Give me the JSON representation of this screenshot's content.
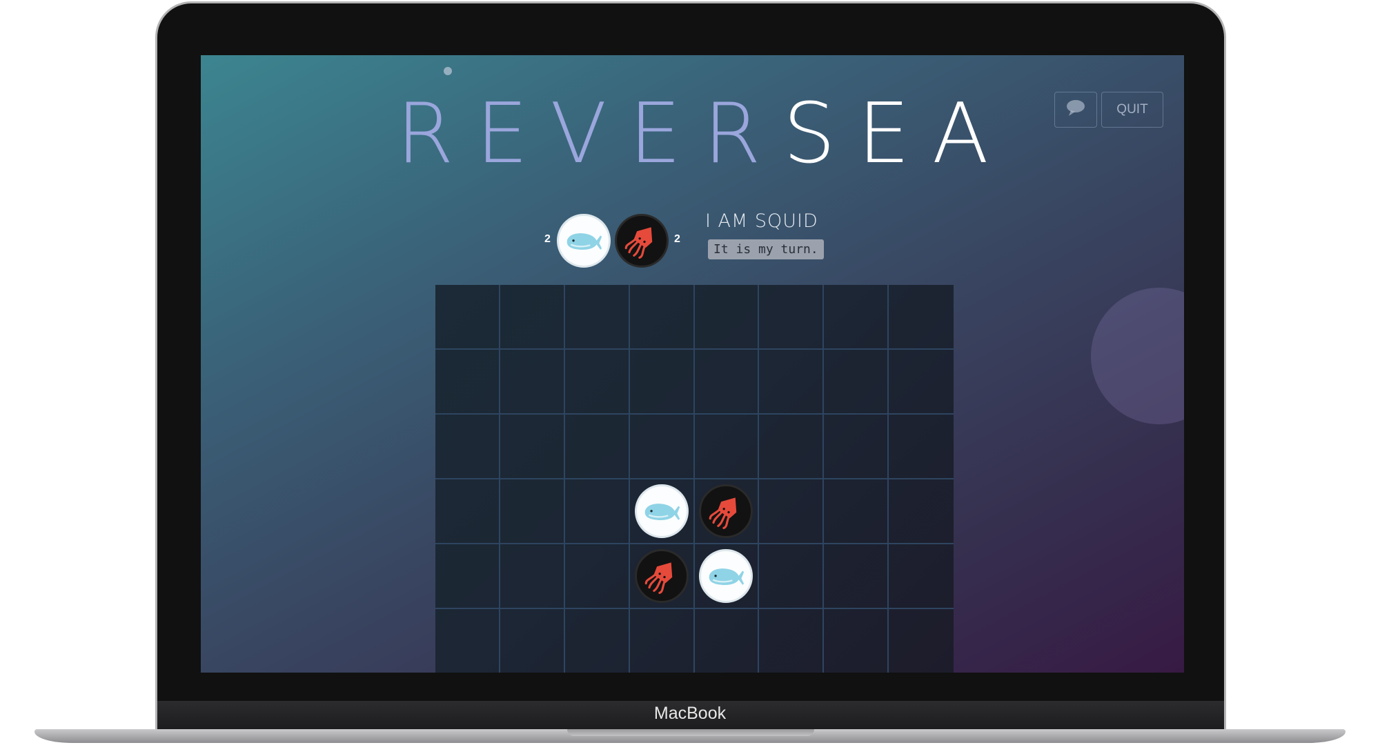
{
  "device": {
    "label": "MacBook"
  },
  "app": {
    "title_prefix": "REVER",
    "title_suffix": "SEA"
  },
  "header": {
    "chat_icon": "speech-bubble-icon",
    "quit_label": "QUIT"
  },
  "score": {
    "whale": "2",
    "squid": "2"
  },
  "player": {
    "name": "I AM SQUID",
    "status": "It is my turn."
  },
  "board": {
    "columns": 8,
    "rows_visible": 6,
    "pieces": [
      {
        "row": 3,
        "col": 3,
        "piece": "whale"
      },
      {
        "row": 3,
        "col": 4,
        "piece": "squid"
      },
      {
        "row": 4,
        "col": 3,
        "piece": "squid"
      },
      {
        "row": 4,
        "col": 4,
        "piece": "whale"
      }
    ]
  },
  "colors": {
    "whale": "#8fd3e6",
    "squid": "#e64a3b"
  },
  "icons": {
    "whale": "whale-icon",
    "squid": "squid-icon"
  }
}
